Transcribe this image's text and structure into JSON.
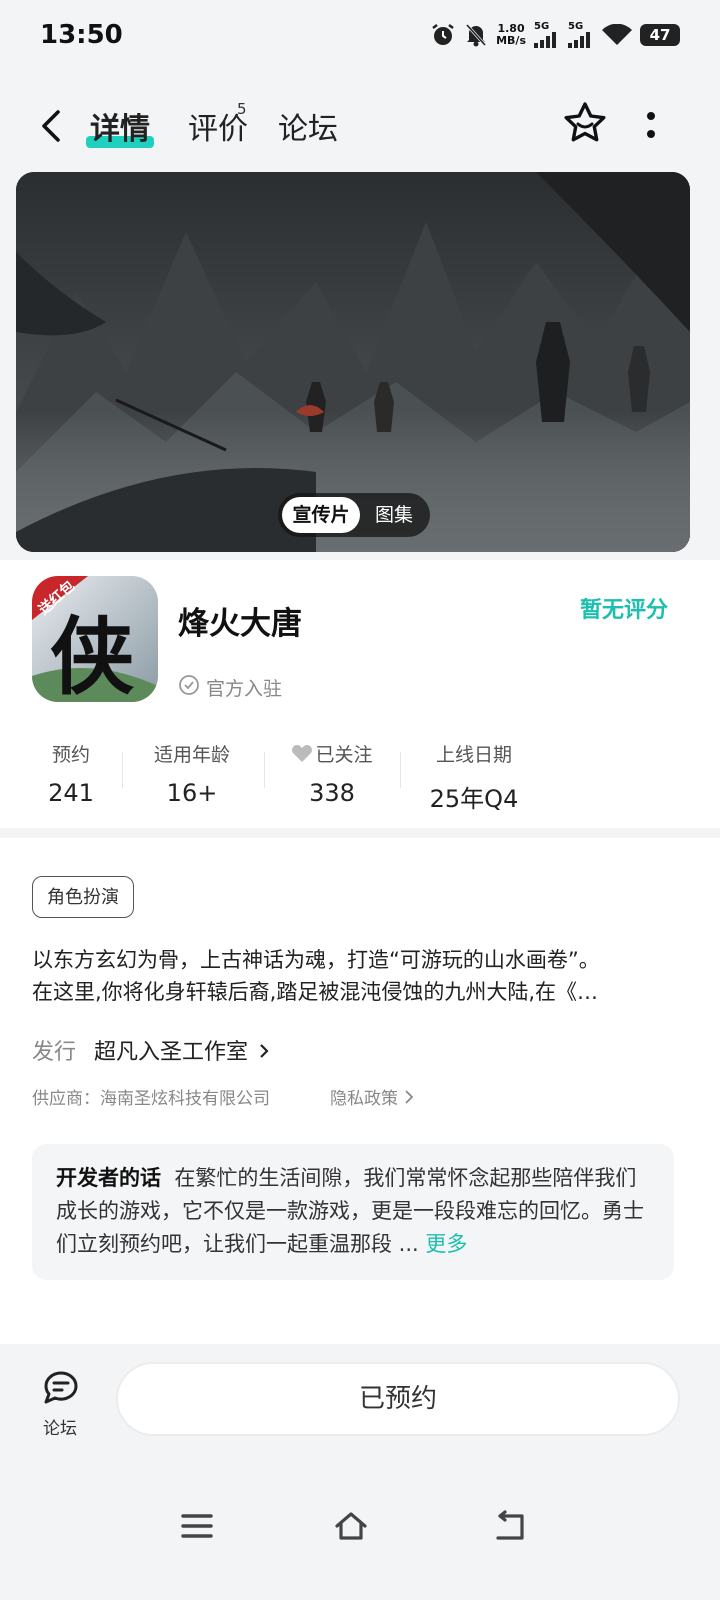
{
  "status_bar": {
    "time": "13:50",
    "net_speed_value": "1.80",
    "net_speed_unit": "MB/s",
    "sim1": "5G",
    "sim2": "5G",
    "battery": "47"
  },
  "nav": {
    "tabs": [
      {
        "label": "详情",
        "active": true
      },
      {
        "label": "评价",
        "badge": "5"
      },
      {
        "label": "论坛"
      }
    ]
  },
  "media": {
    "promo_label": "宣传片",
    "gallery_label": "图集"
  },
  "game": {
    "icon_badge": "送红包",
    "icon_glyph": "侠",
    "title": "烽火大唐",
    "rating": "暂无评分",
    "official": "官方入驻"
  },
  "stats": [
    {
      "label": "预约",
      "value": "241"
    },
    {
      "label": "适用年龄",
      "value": "16+"
    },
    {
      "label": "已关注",
      "value": "338"
    },
    {
      "label": "上线日期",
      "value": "25年Q4"
    }
  ],
  "details": {
    "genre_tag": "角色扮演",
    "description_line1": "以东方玄幻为骨，上古神话为魂，打造“可游玩的山水画卷”。",
    "description_line2": "在这里,你将化身轩辕后裔,踏足被混沌侵蚀的九州大陆,在《…",
    "publisher_label": "发行",
    "publisher_name": "超凡入圣工作室",
    "supplier": "供应商：海南圣炫科技有限公司",
    "privacy": "隐私政策"
  },
  "developer_note": {
    "title": "开发者的话",
    "text": "在繁忙的生活间隙，我们常常怀念起那些陪伴我们成长的游戏，它不仅是一款游戏，更是一段段难忘的回忆。勇士们立刻预约吧，让我们一起重温那段 ...",
    "more": "更多"
  },
  "bottom": {
    "forum_label": "论坛",
    "reserve_label": "已预约"
  },
  "colors": {
    "accent": "#1cbfae",
    "tab_underline": "#1fd0be"
  }
}
